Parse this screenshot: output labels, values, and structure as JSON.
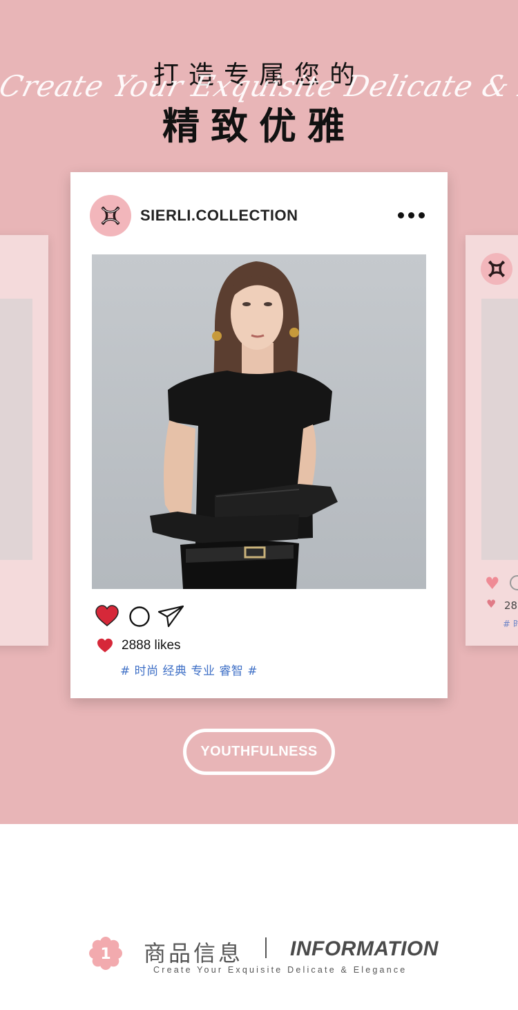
{
  "hero": {
    "title_line1": "打造专属您的",
    "title_script": "Create Your Exquisite Delicate & Elegance",
    "title_line2": "精致优雅"
  },
  "post": {
    "account_name": "SIERLI.COLLECTION",
    "more_icon": "more-dots-icon",
    "likes_text": "2888 likes",
    "hashtags": "# 时尚 经典 专业 睿智 #",
    "actions": [
      "heart-icon",
      "comment-icon",
      "share-icon"
    ]
  },
  "side_card": {
    "likes_partial": "28",
    "tag_partial": "# 时"
  },
  "cta": {
    "label": "YOUTHFULNESS"
  },
  "info_section": {
    "number": "1",
    "title_cn": "商品信息",
    "title_en": "INFORMATION",
    "subtitle": "Create Your Exquisite Delicate & Elegance"
  },
  "colors": {
    "hero_bg": "#e8b5b7",
    "heart_red": "#d62839",
    "hashtag_blue": "#3e6fc6",
    "avatar_pink": "#f2b6bb"
  }
}
